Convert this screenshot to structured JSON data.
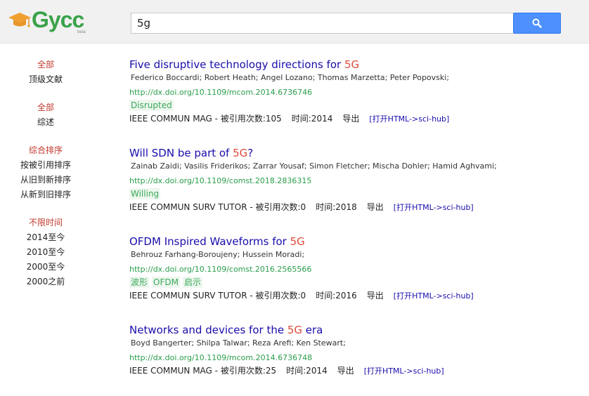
{
  "header": {
    "logo_text": "Gycc",
    "logo_beta": "beta",
    "search_value": "5g",
    "search_icon": "search-icon"
  },
  "sidebar": {
    "groups": [
      {
        "items": [
          {
            "label": "全部",
            "active": true
          },
          {
            "label": "顶级文献",
            "active": false
          }
        ]
      },
      {
        "items": [
          {
            "label": "全部",
            "active": true
          },
          {
            "label": "综述",
            "active": false
          }
        ]
      },
      {
        "items": [
          {
            "label": "综合排序",
            "active": true
          },
          {
            "label": "按被引用排序",
            "active": false
          },
          {
            "label": "从旧到新排序",
            "active": false
          },
          {
            "label": "从新到旧排序",
            "active": false
          }
        ]
      },
      {
        "items": [
          {
            "label": "不限时间",
            "active": true
          },
          {
            "label": "2014至今",
            "active": false
          },
          {
            "label": "2010至今",
            "active": false
          },
          {
            "label": "2000至今",
            "active": false
          },
          {
            "label": "2000之前",
            "active": false
          }
        ]
      }
    ]
  },
  "results": [
    {
      "title_pre": "Five disruptive technology directions for ",
      "title_kw": "5G",
      "title_post": "",
      "authors": "Federico Boccardi;  Robert Heath;  Angel Lozano;  Thomas Marzetta;  Peter Popovski;",
      "doi": "http://dx.doi.org/10.1109/mcom.2014.6736746",
      "tags": [
        "Disrupted"
      ],
      "journal": "IEEE COMMUN MAG - 被引用次数:105",
      "time": "时间:2014",
      "export": "导出",
      "open": "[打开HTML->sci-hub]"
    },
    {
      "title_pre": "Will SDN be part of ",
      "title_kw": "5G",
      "title_post": "?",
      "authors": "Zainab Zaidi;  Vasilis Friderikos;  Zarrar Yousaf;  Simon Fletcher;  Mischa Dohler;  Hamid Aghvami;",
      "doi": "http://dx.doi.org/10.1109/comst.2018.2836315",
      "tags": [
        "Willing"
      ],
      "journal": "IEEE COMMUN SURV TUTOR - 被引用次数:0",
      "time": "时间:2018",
      "export": "导出",
      "open": "[打开HTML->sci-hub]"
    },
    {
      "title_pre": "OFDM Inspired Waveforms for ",
      "title_kw": "5G",
      "title_post": "",
      "authors": "Behrouz Farhang-Boroujeny;  Hussein Moradi;",
      "doi": "http://dx.doi.org/10.1109/comst.2016.2565566",
      "tags": [
        "波形",
        "OFDM",
        "启示"
      ],
      "journal": "IEEE COMMUN SURV TUTOR - 被引用次数:0",
      "time": "时间:2016",
      "export": "导出",
      "open": "[打开HTML->sci-hub]"
    },
    {
      "title_pre": "Networks and devices for the ",
      "title_kw": "5G",
      "title_post": " era",
      "authors": "Boyd Bangerter;  Shilpa Talwar;  Reza Arefi;  Ken Stewart;",
      "doi": "http://dx.doi.org/10.1109/mcom.2014.6736748",
      "tags": [],
      "journal": "IEEE COMMUN MAG - 被引用次数:25",
      "time": "时间:2014",
      "export": "导出",
      "open": "[打开HTML->sci-hub]"
    }
  ],
  "colors": {
    "title": "#1a0dab",
    "keyword": "#dd4b39",
    "doi": "#2a9d4b",
    "tag_text": "#3aaa5a",
    "sidebar_active": "#c0392b",
    "search_button": "#4d90fe",
    "logo": "#3aa24a"
  }
}
